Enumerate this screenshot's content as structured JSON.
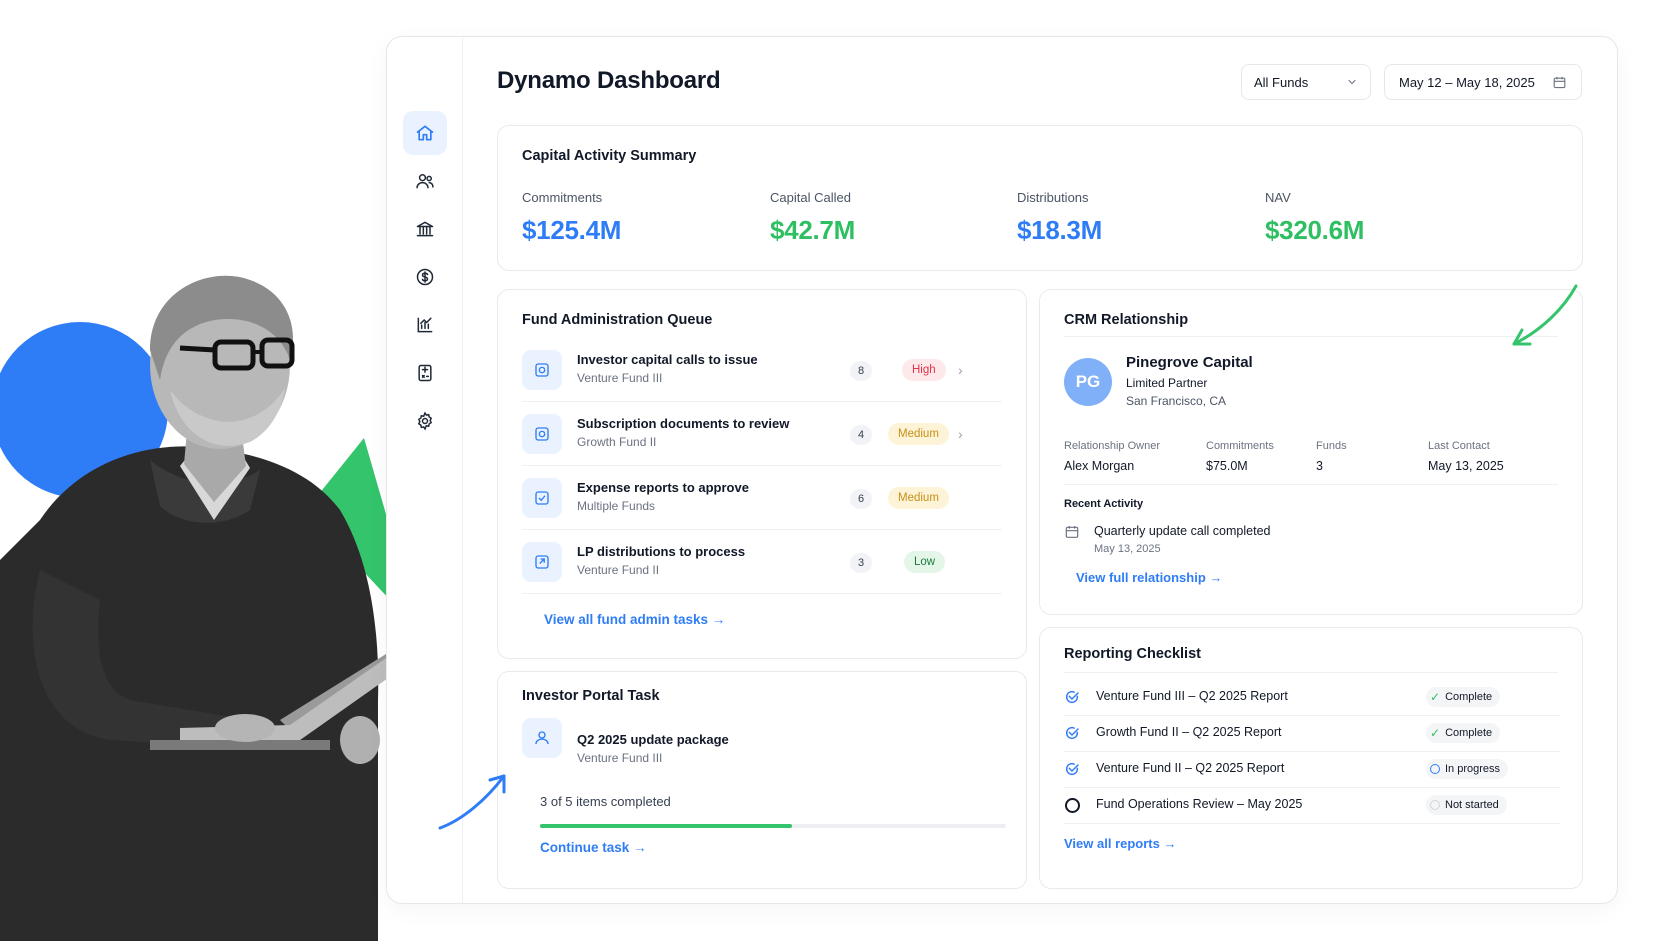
{
  "app": {
    "title": "Dynamo Dashboard"
  },
  "header": {
    "fund_filter": "All Funds",
    "date_range": "May 12 – May 18, 2025"
  },
  "sidebar": {
    "items": [
      {
        "icon": "home-icon",
        "active": true
      },
      {
        "icon": "users-icon"
      },
      {
        "icon": "bank-icon"
      },
      {
        "icon": "dollar-icon"
      },
      {
        "icon": "chart-icon"
      },
      {
        "icon": "calculator-icon"
      },
      {
        "icon": "gear-icon"
      }
    ]
  },
  "summary": {
    "title": "Capital Activity Summary",
    "kpis": [
      {
        "label": "Commitments",
        "value": "$125.4M",
        "color": "#2f7df6"
      },
      {
        "label": "Capital Called",
        "value": "$42.7M",
        "color": "#2fbf63"
      },
      {
        "label": "Distributions",
        "value": "$18.3M",
        "color": "#2f7df6"
      },
      {
        "label": "NAV",
        "value": "$320.6M",
        "color": "#2fbf63"
      }
    ]
  },
  "queue": {
    "title": "Fund Administration Queue",
    "items": [
      {
        "title": "Investor capital calls to issue",
        "sub": "Venture Fund III",
        "count": "8",
        "priority": "High"
      },
      {
        "title": "Subscription documents to review",
        "sub": "Growth Fund II",
        "count": "4",
        "priority": "Medium"
      },
      {
        "title": "Expense reports to approve",
        "sub": "Multiple Funds",
        "count": "6",
        "priority": "Medium"
      },
      {
        "title": "LP distributions to process",
        "sub": "Venture Fund II",
        "count": "3",
        "priority": "Low"
      }
    ],
    "link": "View all fund admin tasks →"
  },
  "portal": {
    "title": "Investor Portal Task",
    "task_title": "Q2 2025 update package",
    "task_sub": "Venture Fund III",
    "progress_text": "3 of 5 items completed",
    "progress_fraction": 0.54,
    "link": "Continue task →"
  },
  "crm": {
    "title": "CRM Relationship",
    "initials": "PG",
    "name": "Pinegrove Capital",
    "role": "Limited Partner",
    "location": "San Francisco, CA",
    "meta": [
      {
        "label": "Relationship Owner",
        "value": "Alex Morgan"
      },
      {
        "label": "Commitments",
        "value": "$75.0M"
      },
      {
        "label": "Funds",
        "value": "3"
      },
      {
        "label": "Last Contact",
        "value": "May 13, 2025"
      }
    ],
    "recent_label": "Recent Activity",
    "activity_title": "Quarterly update call completed",
    "activity_date": "May 13, 2025",
    "link": "View full relationship →"
  },
  "reporting": {
    "title": "Reporting Checklist",
    "items": [
      {
        "label": "Venture Fund III – Q2 2025 Report",
        "status": "Complete",
        "done": true
      },
      {
        "label": "Growth Fund II – Q2 2025 Report",
        "status": "Complete",
        "done": true
      },
      {
        "label": "Venture Fund II – Q2 2025 Report",
        "status": "In progress",
        "done": true
      },
      {
        "label": "Fund Operations Review – May 2025",
        "status": "Not started",
        "done": false
      }
    ],
    "link": "View all reports →"
  },
  "colors": {
    "accent": "#2f7df6",
    "green": "#2fbf63",
    "high_bg": "#fde8ea",
    "high_fg": "#e0364c",
    "medium_bg": "#fdf3d6",
    "medium_fg": "#c7901a",
    "low_bg": "#e3f6e8",
    "low_fg": "#1f7a3e"
  }
}
